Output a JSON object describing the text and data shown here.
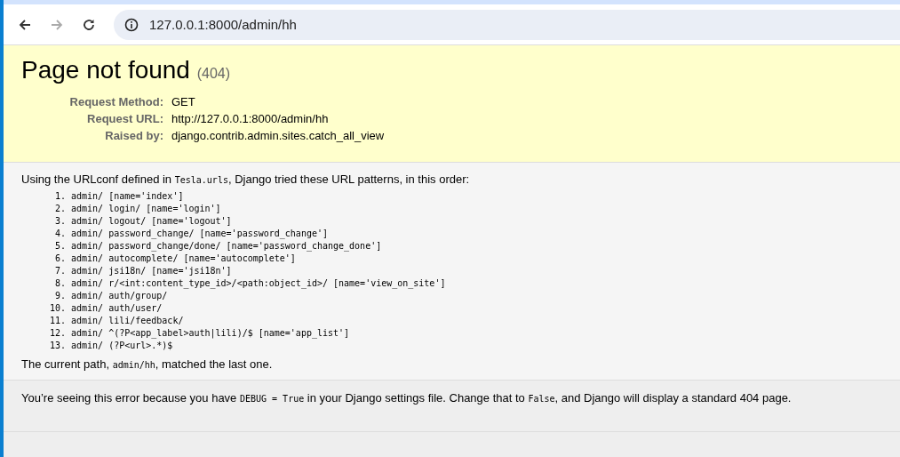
{
  "browser": {
    "url": "127.0.0.1:8000/admin/hh",
    "forward_disabled": true
  },
  "summary": {
    "title": "Page not found",
    "code": "(404)",
    "fields": [
      {
        "label": "Request Method:",
        "value": "GET"
      },
      {
        "label": "Request URL:",
        "value": "http://127.0.0.1:8000/admin/hh"
      },
      {
        "label": "Raised by:",
        "value": "django.contrib.admin.sites.catch_all_view"
      }
    ]
  },
  "info": {
    "intro": [
      {
        "text": "Using the URLconf defined in ",
        "code": false
      },
      {
        "text": "Tesla.urls",
        "code": true
      },
      {
        "text": ", Django tried these URL patterns, in this order:",
        "code": false
      }
    ],
    "patterns": [
      {
        "number": "1.",
        "text": "admin/ [name='index']"
      },
      {
        "number": "2.",
        "text": "admin/ login/ [name='login']"
      },
      {
        "number": "3.",
        "text": "admin/ logout/ [name='logout']"
      },
      {
        "number": "4.",
        "text": "admin/ password_change/ [name='password_change']"
      },
      {
        "number": "5.",
        "text": "admin/ password_change/done/ [name='password_change_done']"
      },
      {
        "number": "6.",
        "text": "admin/ autocomplete/ [name='autocomplete']"
      },
      {
        "number": "7.",
        "text": "admin/ jsi18n/ [name='jsi18n']"
      },
      {
        "number": "8.",
        "text": "admin/ r/<int:content_type_id>/<path:object_id>/ [name='view_on_site']"
      },
      {
        "number": "9.",
        "text": "admin/ auth/group/"
      },
      {
        "number": "10.",
        "text": "admin/ auth/user/"
      },
      {
        "number": "11.",
        "text": "admin/ lili/feedback/"
      },
      {
        "number": "12.",
        "text": "admin/ ^(?P<app_label>auth|lili)/$ [name='app_list']"
      },
      {
        "number": "13.",
        "text": "admin/ (?P<url>.*)$"
      }
    ],
    "outro": [
      {
        "text": "The current path, ",
        "code": false
      },
      {
        "text": "admin/hh",
        "code": true
      },
      {
        "text": ", matched the last one.",
        "code": false
      }
    ]
  },
  "explanation": [
    {
      "text": "You’re seeing this error because you have ",
      "code": false
    },
    {
      "text": "DEBUG = True",
      "code": true
    },
    {
      "text": " in your Django settings file. Change that to ",
      "code": false
    },
    {
      "text": "False",
      "code": true
    },
    {
      "text": ", and Django will display a standard 404 page.",
      "code": false
    }
  ]
}
